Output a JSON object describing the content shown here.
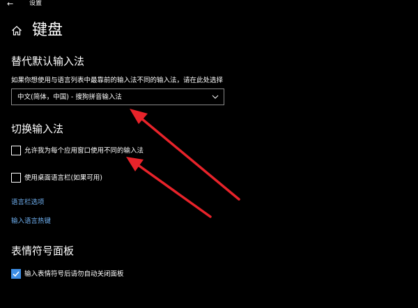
{
  "window": {
    "back_glyph": "←",
    "title": "设置"
  },
  "header": {
    "home_icon": "home-icon",
    "title": "键盘"
  },
  "default_input": {
    "heading": "替代默认输入法",
    "description": "如果你想使用与语言列表中最靠前的输入法不同的输入法，请在此处选择",
    "selected_value": "中文(简体，中国) - 搜狗拼音输入法"
  },
  "switch_input": {
    "heading": "切换输入法",
    "per_app_checkbox": {
      "label": "允许我为每个应用窗口使用不同的输入法",
      "checked": false
    },
    "desktop_bar_checkbox": {
      "label": "使用桌面语言栏(如果可用)",
      "checked": false
    },
    "language_bar_link": "语言栏选项",
    "hotkeys_link": "输入语言热键"
  },
  "emoji_panel": {
    "heading": "表情符号面板",
    "auto_close_checkbox": {
      "label": "输入表情符号后请勿自动关闭面板",
      "checked": true
    }
  },
  "colors": {
    "background": "#000000",
    "text": "#ffffff",
    "link": "#6fb0f0",
    "accent": "#3e8ee5",
    "annotation_arrow": "#e8232a"
  }
}
